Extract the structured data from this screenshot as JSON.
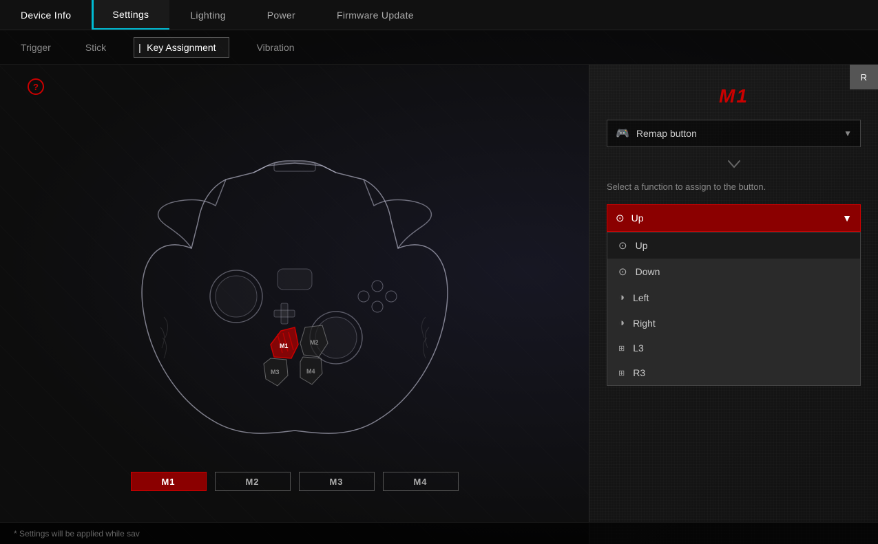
{
  "nav": {
    "items": [
      {
        "label": "Device Info",
        "active": false
      },
      {
        "label": "Settings",
        "active": true
      },
      {
        "label": "Lighting",
        "active": false
      },
      {
        "label": "Power",
        "active": false
      },
      {
        "label": "Firmware Update",
        "active": false
      }
    ]
  },
  "subnav": {
    "items": [
      {
        "label": "Trigger",
        "active": false
      },
      {
        "label": "Stick",
        "active": false
      },
      {
        "label": "Key Assignment",
        "active": true
      },
      {
        "label": "Vibration",
        "active": false
      }
    ]
  },
  "panel": {
    "title": "M1",
    "remap_label": "Remap button",
    "description": "Select a function to assign to the button.",
    "selected_function": "Up",
    "functions": [
      {
        "label": "Up",
        "selected": true
      },
      {
        "label": "Down",
        "selected": false
      },
      {
        "label": "Left",
        "selected": false
      },
      {
        "label": "Right",
        "selected": false
      },
      {
        "label": "L3",
        "selected": false
      },
      {
        "label": "R3",
        "selected": false
      }
    ]
  },
  "m_buttons": [
    {
      "label": "M1",
      "active": true
    },
    {
      "label": "M2",
      "active": false
    },
    {
      "label": "M3",
      "active": false
    },
    {
      "label": "M4",
      "active": false
    }
  ],
  "status": {
    "text": "* Settings will be applied while sav"
  },
  "save_button": "R"
}
